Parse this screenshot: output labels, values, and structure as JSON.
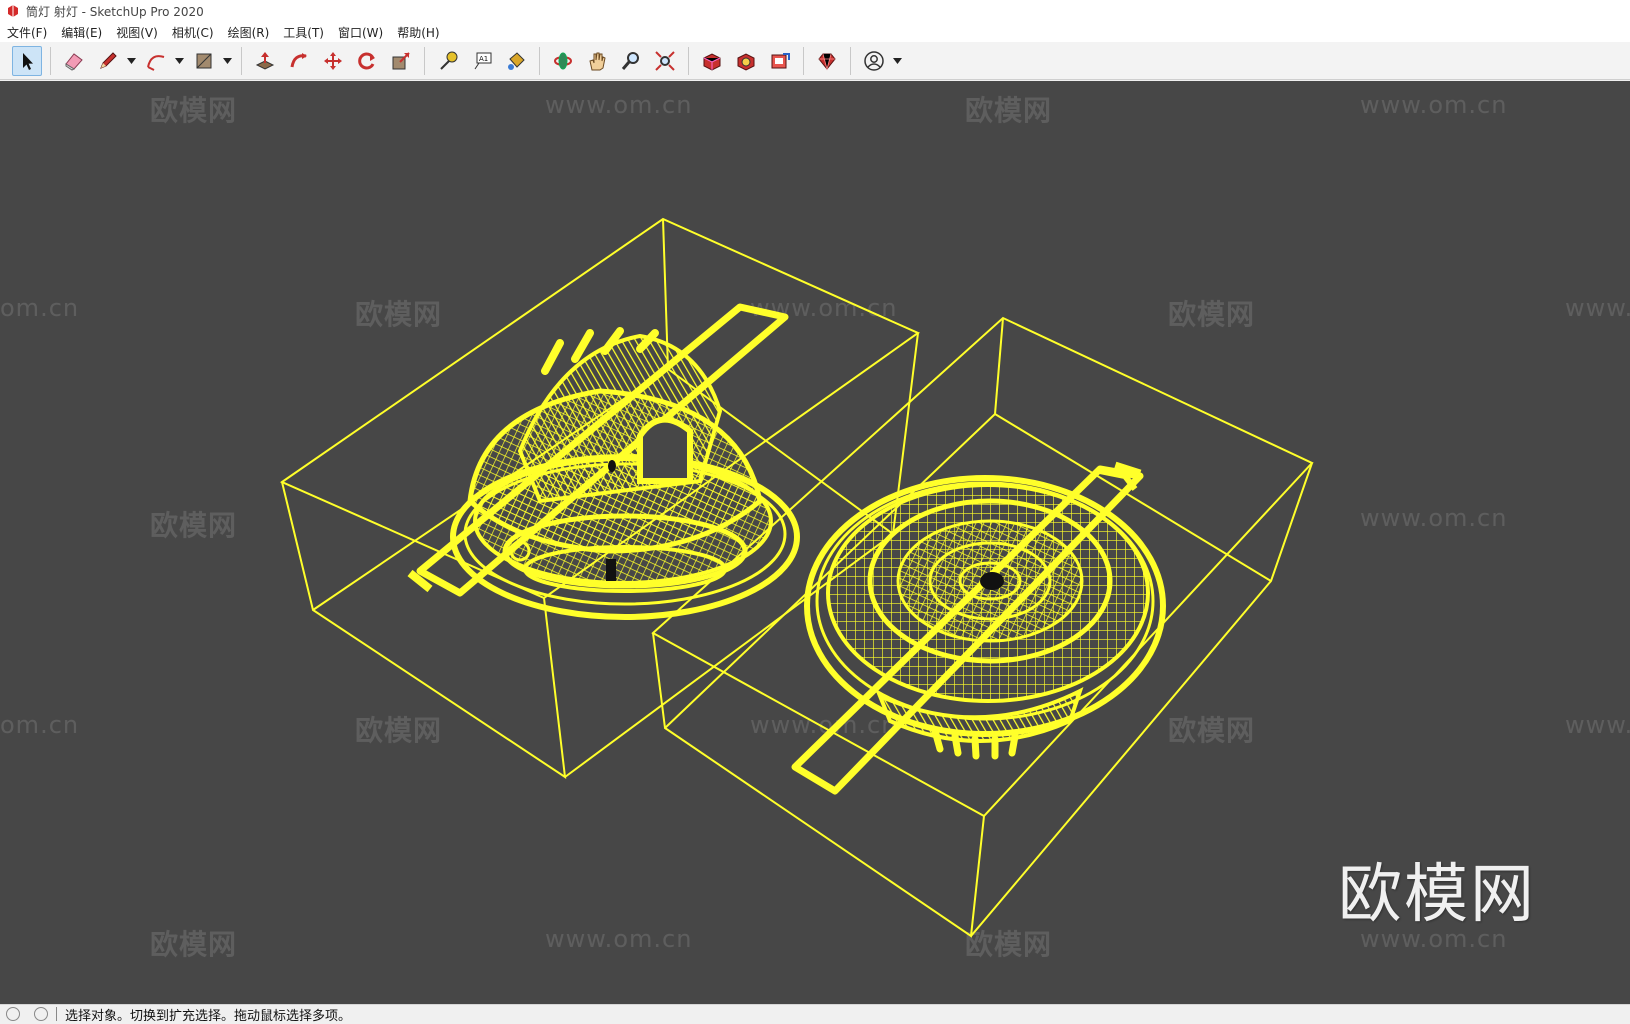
{
  "window": {
    "title": "筒灯 射灯 - SketchUp Pro 2020"
  },
  "menu": {
    "items": [
      "文件(F)",
      "编辑(E)",
      "视图(V)",
      "相机(C)",
      "绘图(R)",
      "工具(T)",
      "窗口(W)",
      "帮助(H)"
    ]
  },
  "toolbar": {
    "tools": [
      "select-icon",
      "eraser-icon",
      "pencil-icon",
      "arc-icon",
      "rectangle-icon",
      "push-pull-icon",
      "follow-me-icon",
      "move-icon",
      "rotate-icon",
      "scale-icon",
      "tape-measure-icon",
      "text-icon",
      "paint-bucket-icon",
      "orbit-icon",
      "pan-icon",
      "zoom-icon",
      "zoom-extents-icon",
      "warehouse-icon",
      "extension-warehouse-icon",
      "layout-icon",
      "ruby-icon",
      "account-icon"
    ],
    "text_tool_label": "A1"
  },
  "watermark": {
    "cn": "欧模网",
    "url": "www.om.cn",
    "url_partial_left": "om.cn",
    "url_partial_right": "www."
  },
  "status": {
    "message": "选择对象。切换到扩充选择。拖动鼠标选择多项。"
  },
  "colors": {
    "viewport": "#474747",
    "wireframe": "#ffff2a"
  }
}
